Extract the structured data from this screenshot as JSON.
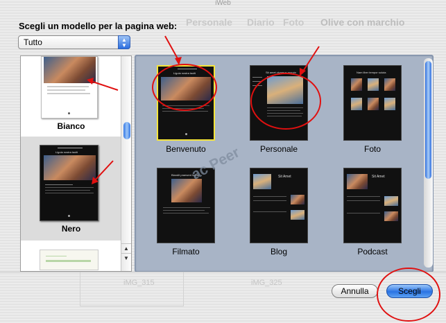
{
  "window": {
    "title": "iWeb"
  },
  "background": {
    "ghost_tabs": [
      "Personale",
      "Diario",
      "Foto",
      "Olive con marchio"
    ],
    "ghost_values": [
      "iMG_315",
      "iMG_325"
    ]
  },
  "sheet": {
    "prompt": "Scegli un modello per la pagina web:",
    "filter_popup": {
      "selected": "Tutto"
    }
  },
  "themes": [
    {
      "label": "Bianco",
      "selected": false
    },
    {
      "label": "Nero",
      "selected": true
    }
  ],
  "templates": [
    {
      "label": "Benvenuto",
      "heading": "Ligula nostra taciti",
      "selected": true
    },
    {
      "label": "Personale",
      "heading": "Sit amet vivamus moroin",
      "selected": false
    },
    {
      "label": "Foto",
      "heading": "Nam liber tempor soluta",
      "selected": false
    },
    {
      "label": "Filmato",
      "heading": "Blandit praesent lupta",
      "selected": false
    },
    {
      "label": "Blog",
      "heading": "Sit Amet",
      "selected": false
    },
    {
      "label": "Podcast",
      "heading": "Sit Amet",
      "selected": false
    }
  ],
  "watermark": "ac Peer",
  "buttons": {
    "cancel": "Annulla",
    "choose": "Scegli"
  },
  "colors": {
    "selection_border": "#f5e53a",
    "annotation_red": "#e01010",
    "panel_bg": "#a8b4c6"
  },
  "icons": {
    "popup_arrows": "updown-arrows-icon"
  }
}
